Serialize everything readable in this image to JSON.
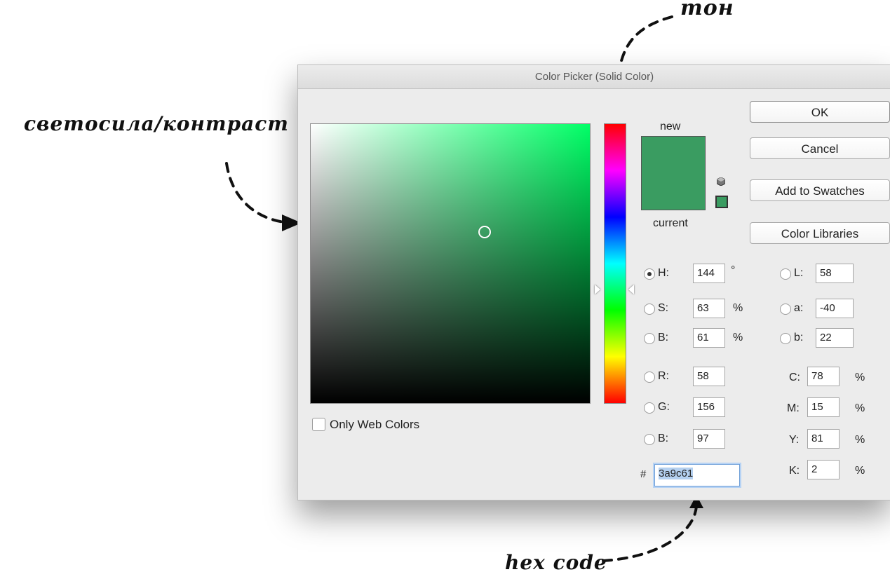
{
  "annotations": {
    "hue": "тон",
    "brightness_contrast": "светосила/контраст",
    "hex": "hex code"
  },
  "window": {
    "title": "Color Picker (Solid Color)"
  },
  "swatch": {
    "new_label": "new",
    "current_label": "current",
    "new_color": "#3a9c61",
    "current_color": "#3a9c61"
  },
  "buttons": {
    "ok": "OK",
    "cancel": "Cancel",
    "add_swatches": "Add to Swatches",
    "libraries": "Color Libraries"
  },
  "hsb": {
    "h": {
      "label": "H:",
      "value": "144",
      "unit": "°"
    },
    "s": {
      "label": "S:",
      "value": "63",
      "unit": "%"
    },
    "b": {
      "label": "B:",
      "value": "61",
      "unit": "%"
    }
  },
  "rgb": {
    "r": {
      "label": "R:",
      "value": "58"
    },
    "g": {
      "label": "G:",
      "value": "156"
    },
    "b": {
      "label": "B:",
      "value": "97"
    }
  },
  "lab": {
    "l": {
      "label": "L:",
      "value": "58"
    },
    "a": {
      "label": "a:",
      "value": "-40"
    },
    "b": {
      "label": "b:",
      "value": "22"
    }
  },
  "cmyk": {
    "c": {
      "label": "C:",
      "value": "78",
      "unit": "%"
    },
    "m": {
      "label": "M:",
      "value": "15",
      "unit": "%"
    },
    "y": {
      "label": "Y:",
      "value": "81",
      "unit": "%"
    },
    "k": {
      "label": "K:",
      "value": "2",
      "unit": "%"
    }
  },
  "hex": {
    "label": "#",
    "value": "3a9c61"
  },
  "web_colors": {
    "label": "Only Web Colors",
    "checked": false
  },
  "selected_mode": "H",
  "colors": {
    "hue_color": "#00ff66"
  }
}
